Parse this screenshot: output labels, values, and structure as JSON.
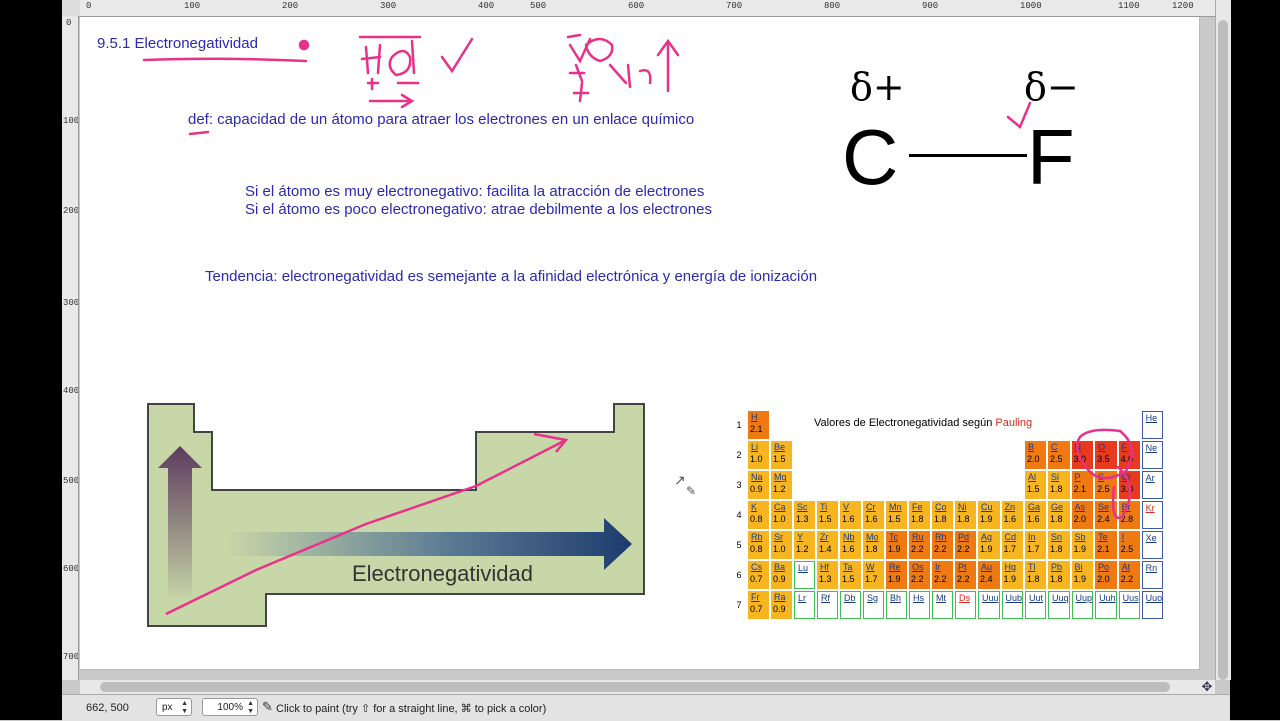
{
  "ruler": {
    "top_ticks": [
      "0",
      "100",
      "200",
      "300",
      "400",
      "500",
      "600",
      "700",
      "800",
      "900",
      "1000",
      "1100",
      "1200"
    ],
    "left_ticks": [
      "0",
      "100",
      "200",
      "300",
      "400",
      "500",
      "600",
      "700"
    ]
  },
  "notes": {
    "heading": "9.5.1 Electronegatividad",
    "definition": "def: capacidad de un átomo para atraer los electrones en un enlace químico",
    "line1": "Si el átomo es muy electronegativo: facilita la atracción de electrones",
    "line2": "Si el átomo es poco electronegativo: atrae debilmente a los electrones",
    "tendency": "Tendencia: electronegatividad es semejante a la afinidad electrónica y energía de ionización"
  },
  "bond_diagram": {
    "left_partial": "δ+",
    "right_partial": "δ−",
    "left_atom": "C",
    "right_atom": "F"
  },
  "trend_figure": {
    "label": "Electronegatividad"
  },
  "periodic_table": {
    "title_prefix": "Valores de Electronegatividad según ",
    "title_highlight": "Pauling",
    "rows": [
      {
        "period": "1",
        "cells": [
          [
            "H",
            "2.1",
            "orange"
          ],
          null,
          null,
          null,
          null,
          null,
          null,
          null,
          null,
          null,
          null,
          null,
          null,
          null,
          null,
          null,
          null,
          [
            "He",
            "",
            "noble"
          ]
        ]
      },
      {
        "period": "2",
        "cells": [
          [
            "Li",
            "1.0",
            "yellow"
          ],
          [
            "Be",
            "1.5",
            "yellow"
          ],
          null,
          null,
          null,
          null,
          null,
          null,
          null,
          null,
          null,
          null,
          [
            "B",
            "2.0",
            "orange"
          ],
          [
            "C",
            "2.5",
            "orange"
          ],
          [
            "N",
            "3.0",
            "red"
          ],
          [
            "O",
            "3.5",
            "red"
          ],
          [
            "F",
            "4.0",
            "red"
          ],
          [
            "Ne",
            "",
            "noble"
          ]
        ]
      },
      {
        "period": "3",
        "cells": [
          [
            "Na",
            "0.9",
            "yellow"
          ],
          [
            "Mg",
            "1.2",
            "yellow"
          ],
          null,
          null,
          null,
          null,
          null,
          null,
          null,
          null,
          null,
          null,
          [
            "Al",
            "1.5",
            "yellow"
          ],
          [
            "Si",
            "1.8",
            "yellow"
          ],
          [
            "P",
            "2.1",
            "orange"
          ],
          [
            "S",
            "2.5",
            "orange"
          ],
          [
            "Cl",
            "3.0",
            "red"
          ],
          [
            "Ar",
            "",
            "noble"
          ]
        ]
      },
      {
        "period": "4",
        "cells": [
          [
            "K",
            "0.8",
            "yellow"
          ],
          [
            "Ca",
            "1.0",
            "yellow"
          ],
          [
            "Sc",
            "1.3",
            "yellow"
          ],
          [
            "Ti",
            "1.5",
            "yellow"
          ],
          [
            "V",
            "1.6",
            "yellow"
          ],
          [
            "Cr",
            "1.6",
            "yellow"
          ],
          [
            "Mn",
            "1.5",
            "yellow"
          ],
          [
            "Fe",
            "1.8",
            "yellow"
          ],
          [
            "Co",
            "1.8",
            "yellow"
          ],
          [
            "Ni",
            "1.8",
            "yellow"
          ],
          [
            "Cu",
            "1.9",
            "yellow"
          ],
          [
            "Zn",
            "1.6",
            "yellow"
          ],
          [
            "Ga",
            "1.6",
            "yellow"
          ],
          [
            "Ge",
            "1.8",
            "yellow"
          ],
          [
            "As",
            "2.0",
            "orange"
          ],
          [
            "Se",
            "2.4",
            "orange"
          ],
          [
            "Br",
            "2.8",
            "orange"
          ],
          [
            "Kr",
            "",
            "noble"
          ]
        ]
      },
      {
        "period": "5",
        "cells": [
          [
            "Rb",
            "0.8",
            "yellow"
          ],
          [
            "Sr",
            "1.0",
            "yellow"
          ],
          [
            "Y",
            "1.2",
            "yellow"
          ],
          [
            "Zr",
            "1.4",
            "yellow"
          ],
          [
            "Nb",
            "1.6",
            "yellow"
          ],
          [
            "Mo",
            "1.8",
            "yellow"
          ],
          [
            "Tc",
            "1.9",
            "orange"
          ],
          [
            "Ru",
            "2.2",
            "orange"
          ],
          [
            "Rh",
            "2.2",
            "orange"
          ],
          [
            "Pd",
            "2.2",
            "orange"
          ],
          [
            "Ag",
            "1.9",
            "yellow"
          ],
          [
            "Cd",
            "1.7",
            "yellow"
          ],
          [
            "In",
            "1.7",
            "yellow"
          ],
          [
            "Sn",
            "1.8",
            "yellow"
          ],
          [
            "Sb",
            "1.9",
            "yellow"
          ],
          [
            "Te",
            "2.1",
            "orange"
          ],
          [
            "I",
            "2.5",
            "orange"
          ],
          [
            "Xe",
            "",
            "noble"
          ]
        ]
      },
      {
        "period": "6",
        "cells": [
          [
            "Cs",
            "0.7",
            "yellow"
          ],
          [
            "Ba",
            "0.9",
            "yellow"
          ],
          [
            "Lu",
            "",
            "empty"
          ],
          [
            "Hf",
            "1.3",
            "yellow"
          ],
          [
            "Ta",
            "1.5",
            "yellow"
          ],
          [
            "W",
            "1.7",
            "yellow"
          ],
          [
            "Re",
            "1.9",
            "orange"
          ],
          [
            "Os",
            "2.2",
            "orange"
          ],
          [
            "Ir",
            "2.2",
            "orange"
          ],
          [
            "Pt",
            "2.2",
            "orange"
          ],
          [
            "Au",
            "2.4",
            "orange"
          ],
          [
            "Hg",
            "1.9",
            "yellow"
          ],
          [
            "Tl",
            "1.8",
            "yellow"
          ],
          [
            "Pb",
            "1.8",
            "yellow"
          ],
          [
            "Bi",
            "1.9",
            "yellow"
          ],
          [
            "Po",
            "2.0",
            "orange"
          ],
          [
            "At",
            "2.2",
            "orange"
          ],
          [
            "Rn",
            "",
            "noble"
          ]
        ]
      },
      {
        "period": "7",
        "cells": [
          [
            "Fr",
            "0.7",
            "yellow"
          ],
          [
            "Ra",
            "0.9",
            "yellow"
          ],
          [
            "Lr",
            "",
            "empty"
          ],
          [
            "Rf",
            "",
            "empty"
          ],
          [
            "Db",
            "",
            "empty"
          ],
          [
            "Sg",
            "",
            "empty"
          ],
          [
            "Bh",
            "",
            "empty"
          ],
          [
            "Hs",
            "",
            "empty"
          ],
          [
            "Mt",
            "",
            "empty"
          ],
          [
            "Ds",
            "",
            "empty"
          ],
          [
            "Uuu",
            "",
            "empty"
          ],
          [
            "Uub",
            "",
            "empty"
          ],
          [
            "Uut",
            "",
            "empty"
          ],
          [
            "Uuq",
            "",
            "empty"
          ],
          [
            "Uup",
            "",
            "empty"
          ],
          [
            "Uuh",
            "",
            "empty"
          ],
          [
            "Uus",
            "",
            "empty"
          ],
          [
            "Uuo",
            "",
            "noble"
          ]
        ]
      }
    ],
    "colors": {
      "yellow": "#f7b522",
      "orange": "#ef7a12",
      "red": "#e83a1c",
      "noble": "#ffffff",
      "empty": "#ffffff"
    }
  },
  "status": {
    "coords": "662, 500",
    "unit": "px",
    "zoom": "100%",
    "message": "Click to paint (try ⇧ for a straight line, ⌘ to pick a color)"
  },
  "colors": {
    "note_text": "#2a2ab0",
    "ink_pink": "#e8318a",
    "figure_green": "#c8d7a8"
  }
}
